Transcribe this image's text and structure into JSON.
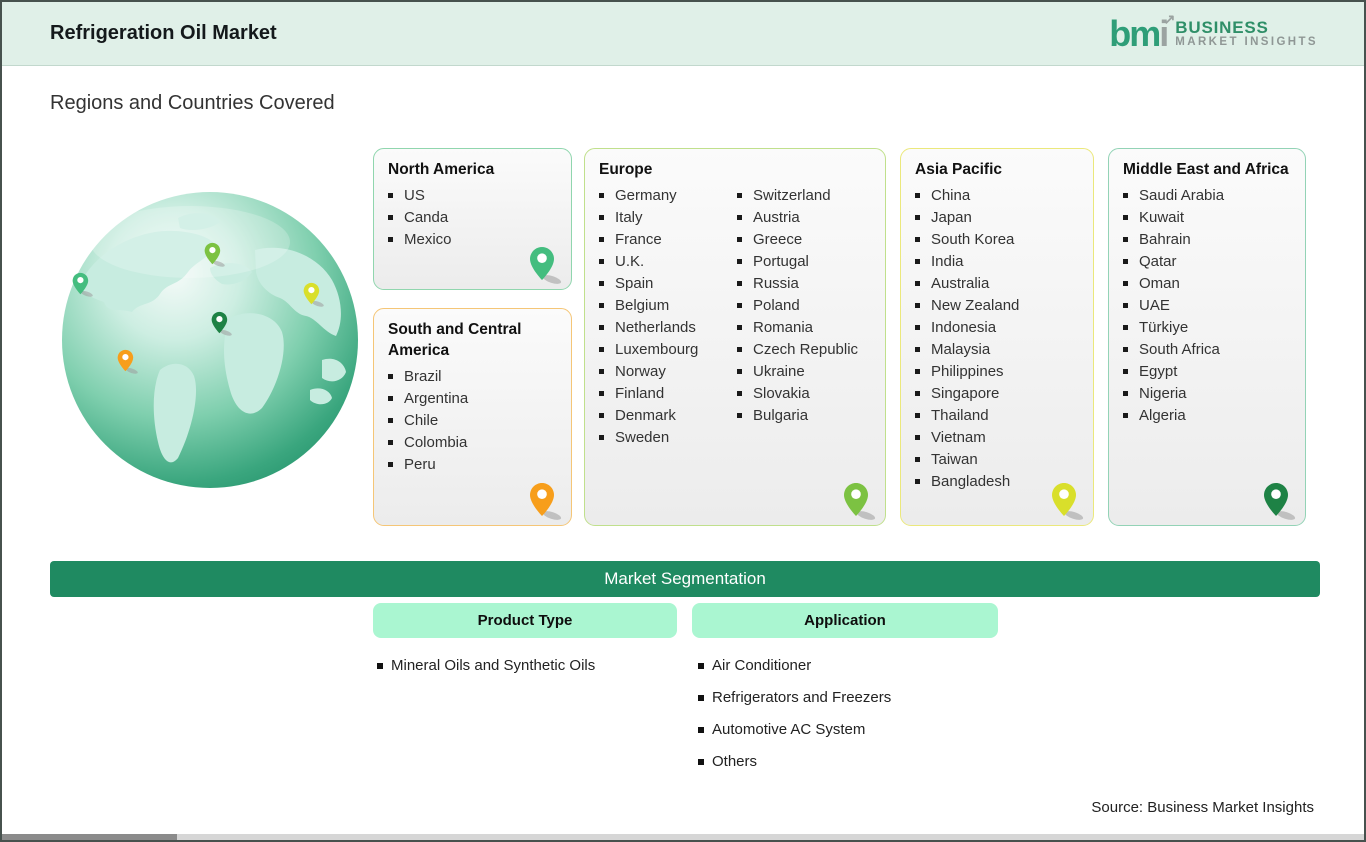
{
  "header": {
    "title": "Refrigeration Oil Market"
  },
  "logo": {
    "monogram_green": "bm",
    "monogram_gray": "i",
    "arrow": "↗",
    "line1": "BUSINESS",
    "line2": "MARKET INSIGHTS"
  },
  "subtitle": "Regions and Countries Covered",
  "regions": [
    {
      "name": "North America",
      "countries": [
        "US",
        "Canda",
        "Mexico"
      ],
      "border_color": "#90d6ae",
      "pin_color": "#44bd7f"
    },
    {
      "name": "South and Central America",
      "countries": [
        "Brazil",
        "Argentina",
        "Chile",
        "Colombia",
        "Peru"
      ],
      "border_color": "#f5c677",
      "pin_color": "#f79e1b"
    },
    {
      "name": "Europe",
      "countries": [
        "Germany",
        "Italy",
        "France",
        "U.K.",
        "Spain",
        "Belgium",
        "Netherlands",
        "Luxembourg",
        "Norway",
        "Finland",
        "Denmark",
        "Sweden",
        "Switzerland",
        "Austria",
        "Greece",
        "Portugal",
        "Russia",
        "Poland",
        "Romania",
        "Czech Republic",
        "Ukraine",
        "Slovakia",
        "Bulgaria"
      ],
      "split_at": 12,
      "border_color": "#c0e08c",
      "pin_color": "#7cc242"
    },
    {
      "name": "Asia Pacific",
      "countries": [
        "China",
        "Japan",
        "South Korea",
        "India",
        "Australia",
        "New Zealand",
        "Indonesia",
        "Malaysia",
        "Philippines",
        "Singapore",
        "Thailand",
        "Vietnam",
        "Taiwan",
        "Bangladesh"
      ],
      "border_color": "#ebe87c",
      "pin_color": "#d9df2b"
    },
    {
      "name": "Middle East and Africa",
      "countries": [
        "Saudi Arabia",
        "Kuwait",
        "Bahrain",
        "Qatar",
        "Oman",
        "UAE",
        "Türkiye",
        "South Africa",
        "Egypt",
        "Nigeria",
        "Algeria"
      ],
      "border_color": "#93d3b6",
      "pin_color": "#1e8245"
    }
  ],
  "segmentation": {
    "title": "Market Segmentation",
    "bar_color": "#1f8a61",
    "chip_color": "#aaf6d1",
    "columns": [
      {
        "label": "Product Type",
        "items": [
          "Mineral Oils and Synthetic Oils"
        ]
      },
      {
        "label": "Application",
        "items": [
          "Air Conditioner",
          "Refrigerators and Freezers",
          "Automotive AC System",
          "Others"
        ]
      }
    ]
  },
  "source": "Source: Business Market Insights"
}
